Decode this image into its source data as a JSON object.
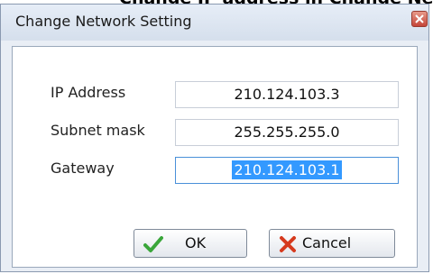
{
  "caption": "Change IP address in Change Network Setting",
  "window": {
    "title": "Change Network Setting"
  },
  "fields": [
    {
      "label": "IP Address",
      "value": "210.124.103.3"
    },
    {
      "label": "Subnet mask",
      "value": "255.255.255.0"
    },
    {
      "label": "Gateway",
      "value": "210.124.103.1"
    }
  ],
  "buttons": {
    "ok_label": "OK",
    "cancel_label": "Cancel"
  },
  "icons": {
    "close": "close-icon",
    "ok": "checkmark-icon",
    "cancel": "cross-icon"
  },
  "colors": {
    "selection": "#3399ff",
    "ok_icon": "#3aa63a",
    "cancel_icon": "#d63a1e",
    "close_button": "#c4453a"
  }
}
